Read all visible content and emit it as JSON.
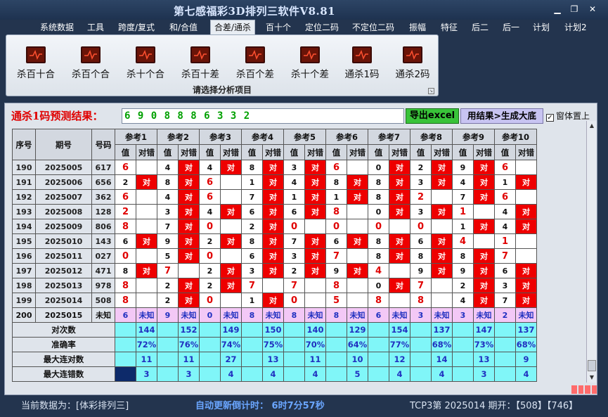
{
  "app": {
    "title": "第七感福彩3D排列三软件V8.81",
    "win_minimize": "▁",
    "win_restore": "❐",
    "win_close": "✕"
  },
  "menu": [
    {
      "label": "系统数据",
      "active": false
    },
    {
      "label": "工具",
      "active": false
    },
    {
      "label": "跨度/复式",
      "active": false
    },
    {
      "label": "和/合值",
      "active": false
    },
    {
      "label": "合差/通杀",
      "active": true
    },
    {
      "label": "百十个",
      "active": false
    },
    {
      "label": "定位二码",
      "active": false
    },
    {
      "label": "不定位二码",
      "active": false
    },
    {
      "label": "振幅",
      "active": false
    },
    {
      "label": "特征",
      "active": false
    },
    {
      "label": "后二",
      "active": false
    },
    {
      "label": "后一",
      "active": false
    },
    {
      "label": "计划",
      "active": false
    },
    {
      "label": "计划2",
      "active": false
    }
  ],
  "ribbon": {
    "caption": "请选择分析项目",
    "items": [
      {
        "label": "杀百十合",
        "icon": "chart-icon"
      },
      {
        "label": "杀百个合",
        "icon": "chart-icon"
      },
      {
        "label": "杀十个合",
        "icon": "chart-icon"
      },
      {
        "label": "杀百十差",
        "icon": "chart-icon"
      },
      {
        "label": "杀百个差",
        "icon": "chart-icon"
      },
      {
        "label": "杀十个差",
        "icon": "chart-icon"
      },
      {
        "label": "通杀1码",
        "icon": "chart-icon"
      },
      {
        "label": "通杀2码",
        "icon": "chart-icon"
      }
    ]
  },
  "prediction": {
    "label": "通杀1码预测结果：",
    "value": "6 9 0 8 8 8 6 3 3 2",
    "excel_button": "导出excel",
    "generate_button": "用结果>生成大底",
    "topmost_label": "窗体置上",
    "topmost_checked": true
  },
  "table": {
    "col_seq": "序号",
    "col_period": "期号",
    "col_num": "号码",
    "refs": [
      "参考1",
      "参考2",
      "参考3",
      "参考4",
      "参考5",
      "参考6",
      "参考7",
      "参考8",
      "参考9",
      "参考10"
    ],
    "sub_val": "值",
    "sub_hit": "对错",
    "hit_mark": "对",
    "rows": [
      {
        "seq": "190",
        "period": "2025005",
        "num": "617",
        "cells": [
          [
            "6",
            "",
            1
          ],
          [
            "4",
            "对",
            0
          ],
          [
            "4",
            "对",
            0
          ],
          [
            "8",
            "对",
            0
          ],
          [
            "3",
            "对",
            0
          ],
          [
            "6",
            "",
            1
          ],
          [
            "0",
            "对",
            0
          ],
          [
            "2",
            "对",
            0
          ],
          [
            "9",
            "对",
            0
          ],
          [
            "6",
            "",
            1
          ]
        ]
      },
      {
        "seq": "191",
        "period": "2025006",
        "num": "656",
        "cells": [
          [
            "2",
            "对",
            0
          ],
          [
            "8",
            "对",
            0
          ],
          [
            "6",
            "",
            1
          ],
          [
            "1",
            "对",
            0
          ],
          [
            "4",
            "对",
            0
          ],
          [
            "8",
            "对",
            0
          ],
          [
            "8",
            "对",
            0
          ],
          [
            "3",
            "对",
            0
          ],
          [
            "4",
            "对",
            0
          ],
          [
            "1",
            "对",
            0
          ]
        ]
      },
      {
        "seq": "192",
        "period": "2025007",
        "num": "362",
        "cells": [
          [
            "6",
            "",
            1
          ],
          [
            "4",
            "对",
            0
          ],
          [
            "6",
            "",
            1
          ],
          [
            "7",
            "对",
            0
          ],
          [
            "1",
            "对",
            0
          ],
          [
            "1",
            "对",
            0
          ],
          [
            "8",
            "对",
            0
          ],
          [
            "2",
            "",
            1
          ],
          [
            "7",
            "对",
            0
          ],
          [
            "6",
            "",
            1
          ]
        ]
      },
      {
        "seq": "193",
        "period": "2025008",
        "num": "128",
        "cells": [
          [
            "2",
            "",
            1
          ],
          [
            "3",
            "对",
            0
          ],
          [
            "4",
            "对",
            0
          ],
          [
            "6",
            "对",
            0
          ],
          [
            "6",
            "对",
            0
          ],
          [
            "8",
            "",
            1
          ],
          [
            "0",
            "对",
            0
          ],
          [
            "3",
            "对",
            0
          ],
          [
            "1",
            "",
            1
          ],
          [
            "4",
            "对",
            0
          ]
        ]
      },
      {
        "seq": "194",
        "period": "2025009",
        "num": "806",
        "cells": [
          [
            "8",
            "",
            1
          ],
          [
            "7",
            "对",
            0
          ],
          [
            "0",
            "",
            1
          ],
          [
            "2",
            "对",
            0
          ],
          [
            "0",
            "",
            1
          ],
          [
            "0",
            "",
            1
          ],
          [
            "0",
            "",
            1
          ],
          [
            "0",
            "",
            1
          ],
          [
            "1",
            "对",
            0
          ],
          [
            "4",
            "对",
            0
          ]
        ]
      },
      {
        "seq": "195",
        "period": "2025010",
        "num": "143",
        "cells": [
          [
            "6",
            "对",
            0
          ],
          [
            "9",
            "对",
            0
          ],
          [
            "2",
            "对",
            0
          ],
          [
            "8",
            "对",
            0
          ],
          [
            "7",
            "对",
            0
          ],
          [
            "6",
            "对",
            0
          ],
          [
            "8",
            "对",
            0
          ],
          [
            "6",
            "对",
            0
          ],
          [
            "4",
            "",
            1
          ],
          [
            "1",
            "",
            1
          ]
        ]
      },
      {
        "seq": "196",
        "period": "2025011",
        "num": "027",
        "cells": [
          [
            "0",
            "",
            1
          ],
          [
            "5",
            "对",
            0
          ],
          [
            "0",
            "",
            1
          ],
          [
            "6",
            "对",
            0
          ],
          [
            "3",
            "对",
            0
          ],
          [
            "7",
            "",
            1
          ],
          [
            "8",
            "对",
            0
          ],
          [
            "8",
            "对",
            0
          ],
          [
            "8",
            "对",
            0
          ],
          [
            "7",
            "",
            1
          ]
        ]
      },
      {
        "seq": "197",
        "period": "2025012",
        "num": "471",
        "cells": [
          [
            "8",
            "对",
            0
          ],
          [
            "7",
            "",
            1
          ],
          [
            "2",
            "对",
            0
          ],
          [
            "3",
            "对",
            0
          ],
          [
            "2",
            "对",
            0
          ],
          [
            "9",
            "对",
            0
          ],
          [
            "4",
            "",
            1
          ],
          [
            "9",
            "对",
            0
          ],
          [
            "9",
            "对",
            0
          ],
          [
            "6",
            "对",
            0
          ]
        ]
      },
      {
        "seq": "198",
        "period": "2025013",
        "num": "978",
        "cells": [
          [
            "8",
            "",
            1
          ],
          [
            "2",
            "对",
            0
          ],
          [
            "2",
            "对",
            0
          ],
          [
            "7",
            "",
            1
          ],
          [
            "7",
            "",
            1
          ],
          [
            "8",
            "",
            1
          ],
          [
            "0",
            "对",
            0
          ],
          [
            "7",
            "",
            1
          ],
          [
            "2",
            "对",
            0
          ],
          [
            "3",
            "对",
            0
          ]
        ]
      },
      {
        "seq": "199",
        "period": "2025014",
        "num": "508",
        "cells": [
          [
            "8",
            "",
            1
          ],
          [
            "2",
            "对",
            0
          ],
          [
            "0",
            "",
            1
          ],
          [
            "1",
            "对",
            0
          ],
          [
            "0",
            "",
            1
          ],
          [
            "5",
            "",
            1
          ],
          [
            "8",
            "",
            1
          ],
          [
            "8",
            "",
            1
          ],
          [
            "4",
            "对",
            0
          ],
          [
            "7",
            "对",
            0
          ]
        ]
      }
    ],
    "pred_row": {
      "seq": "200",
      "period": "2025015",
      "num": "未知",
      "values": [
        "6",
        "9",
        "0",
        "8",
        "8",
        "8",
        "6",
        "3",
        "3",
        "2"
      ],
      "unknown": "未知"
    },
    "stats": [
      {
        "label": "对次数",
        "values": [
          "144",
          "152",
          "149",
          "150",
          "140",
          "129",
          "154",
          "137",
          "147",
          "137"
        ]
      },
      {
        "label": "准确率",
        "values": [
          "72%",
          "76%",
          "74%",
          "75%",
          "70%",
          "64%",
          "77%",
          "68%",
          "73%",
          "68%"
        ]
      },
      {
        "label": "最大连对数",
        "values": [
          "11",
          "11",
          "27",
          "13",
          "11",
          "10",
          "12",
          "14",
          "13",
          "9"
        ]
      },
      {
        "label": "最大连错数",
        "values": [
          "3",
          "3",
          "4",
          "4",
          "4",
          "5",
          "4",
          "4",
          "3",
          "4"
        ]
      }
    ]
  },
  "status": {
    "current_data": "当前数据为：[体彩排列三]",
    "countdown": "自动更新倒计时：  6时7分57秒",
    "draw_info": "TCP3第  2025014  期开：【508】【746】"
  },
  "colors": {
    "hit_red": "#ee0000",
    "predict_pink": "#f3c8f6",
    "stats_cyan": "#80f6f8",
    "value_red": "#e00000",
    "stats_blue": "#2030c0",
    "excel_green": "#39c339"
  }
}
